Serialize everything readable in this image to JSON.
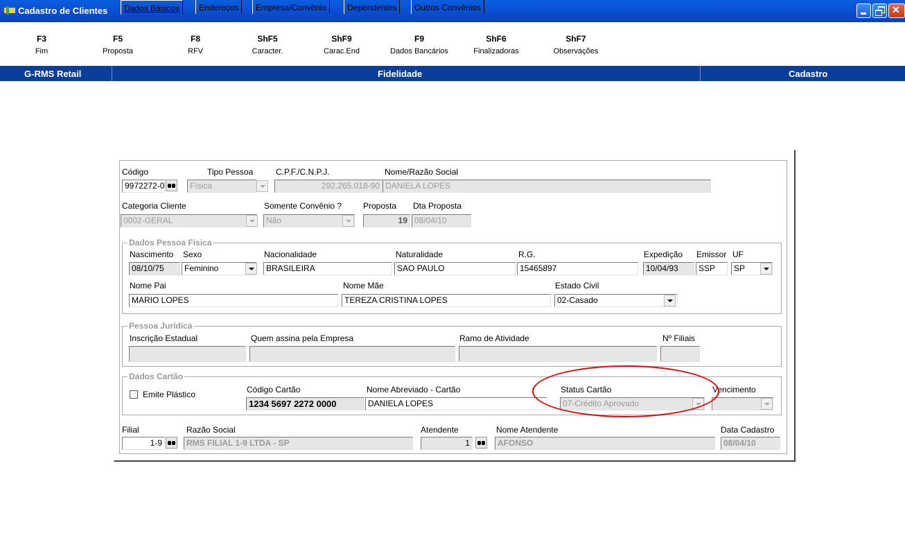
{
  "window": {
    "title": "Cadastro de Clientes"
  },
  "toolbar": [
    {
      "key": "F3",
      "label": "Fim"
    },
    {
      "key": "F5",
      "label": "Proposta"
    },
    {
      "key": "F8",
      "label": "RFV"
    },
    {
      "key": "ShF5",
      "label": "Caracter."
    },
    {
      "key": "ShF9",
      "label": "Carac.End"
    },
    {
      "key": "F9",
      "label": "Dados Bancários"
    },
    {
      "key": "ShF6",
      "label": "Finalizadoras"
    },
    {
      "key": "ShF7",
      "label": "Observações"
    }
  ],
  "statusbar": {
    "left": "G-RMS Retail",
    "center": "Fidelidade",
    "right": "Cadastro"
  },
  "tabs": [
    "Dados Básicos",
    "Endereços",
    "Empresa/Convênio",
    "Dependentes",
    "Outros Convênios"
  ],
  "basic": {
    "codigo_label": "Código",
    "codigo": "9972272-0",
    "tipo_label": "Tipo Pessoa",
    "tipo": "Física",
    "cpf_label": "C.P.F./C.N.P.J.",
    "cpf": "292.265.018-90",
    "nome_label": "Nome/Razão Social",
    "nome": "DANIELA LOPES",
    "categoria_label": "Categoria Cliente",
    "categoria": "0002-GERAL",
    "convenio_label": "Somente Convênio ?",
    "convenio": "Não",
    "proposta_label": "Proposta",
    "proposta": "19",
    "dtproposta_label": "Dta Proposta",
    "dtproposta": "08/04/10"
  },
  "pf": {
    "group": "Dados Pessoa Física",
    "nasc_label": "Nascimento",
    "nasc": "08/10/75",
    "sexo_label": "Sexo",
    "sexo": "Feminino",
    "nac_label": "Nacionalidade",
    "nac": "BRASILEIRA",
    "nat_label": "Naturalidade",
    "nat": "SAO PAULO",
    "rg_label": "R.G.",
    "rg": "15465897",
    "exp_label": "Expedição",
    "exp": "10/04/93",
    "emissor_label": "Emissor",
    "emissor": "SSP",
    "uf_label": "UF",
    "uf": "SP",
    "pai_label": "Nome Pai",
    "pai": "MARIO LOPES",
    "mae_label": "Nome Mãe",
    "mae": "TEREZA CRISTINA LOPES",
    "civil_label": "Estado Civil",
    "civil": "02-Casado"
  },
  "pj": {
    "group": "Pessoa Jurídica",
    "ie_label": "Inscrição Estadual",
    "assina_label": "Quem assina pela Empresa",
    "ramo_label": "Ramo de Atividade",
    "filiais_label": "Nº Filiais"
  },
  "card": {
    "group": "Dados Cartão",
    "emite_label": "Emite Plástico",
    "codigo_label": "Código Cartão",
    "codigo": "1234 5697 2272 0000",
    "nome_label": "Nome Abreviado - Cartão",
    "nome": "DANIELA LOPES",
    "status_label": "Status Cartão",
    "status": "07-Crédito Aprovado",
    "venc_label": "Vencimento"
  },
  "footer": {
    "filial_label": "Filial",
    "filial": "1-9",
    "razao_label": "Razão Social",
    "razao": "RMS FILIAL 1-9 LTDA - SP",
    "atendente_label": "Atendente",
    "atendente": "1",
    "nomeat_label": "Nome Atendente",
    "nomeat": "AFONSO",
    "data_label": "Data Cadastro",
    "data": "08/04/10"
  }
}
